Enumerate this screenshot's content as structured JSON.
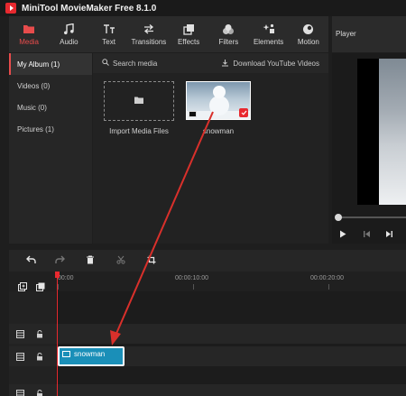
{
  "app": {
    "title": "MiniTool MovieMaker Free 8.1.0",
    "accent_color": "#e8292f"
  },
  "toolbar": {
    "tabs": [
      {
        "label": "Media",
        "icon": "folder-icon",
        "active": true
      },
      {
        "label": "Audio",
        "icon": "music-note-icon",
        "active": false
      },
      {
        "label": "Text",
        "icon": "text-icon",
        "active": false
      },
      {
        "label": "Transitions",
        "icon": "transitions-icon",
        "active": false
      },
      {
        "label": "Effects",
        "icon": "effects-icon",
        "active": false
      },
      {
        "label": "Filters",
        "icon": "filters-icon",
        "active": false
      },
      {
        "label": "Elements",
        "icon": "elements-icon",
        "active": false
      },
      {
        "label": "Motion",
        "icon": "motion-icon",
        "active": false
      }
    ]
  },
  "player": {
    "title": "Player"
  },
  "sidebar": {
    "items": [
      {
        "label": "My Album (1)",
        "active": true
      },
      {
        "label": "Videos (0)",
        "active": false
      },
      {
        "label": "Music (0)",
        "active": false
      },
      {
        "label": "Pictures (1)",
        "active": false
      }
    ]
  },
  "media": {
    "search_placeholder": "Search media",
    "download_label": "Download YouTube Videos",
    "import_label": "Import Media Files",
    "items": [
      {
        "name": "snowman",
        "selected": true
      }
    ]
  },
  "timeline": {
    "ticks": [
      "00:00",
      "00:00:10:00",
      "00:00:20:00"
    ],
    "clip_label": "snowman",
    "clip_color": "#1a8fb8"
  }
}
